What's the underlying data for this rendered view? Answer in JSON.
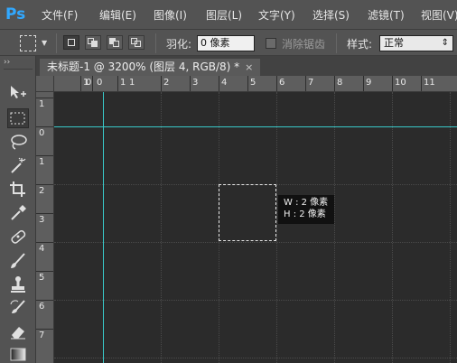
{
  "app": {
    "logo": "Ps"
  },
  "menu": {
    "items": [
      "文件(F)",
      "编辑(E)",
      "图像(I)",
      "图层(L)",
      "文字(Y)",
      "选择(S)",
      "滤镜(T)",
      "视图(V)"
    ]
  },
  "options": {
    "feather_label": "羽化:",
    "feather_value": "0 像素",
    "antialias_label": "消除锯齿",
    "style_label": "样式:",
    "style_value": "正常",
    "style_arrow": "⇕"
  },
  "tools": {
    "collapse": "››",
    "icons": [
      "move-tool-icon",
      "marquee-tool-icon",
      "lasso-tool-icon",
      "magic-wand-tool-icon",
      "crop-tool-icon",
      "eyedropper-tool-icon",
      "healing-brush-tool-icon",
      "brush-tool-icon",
      "clone-stamp-tool-icon",
      "history-brush-tool-icon",
      "eraser-tool-icon",
      "gradient-tool-icon"
    ]
  },
  "document": {
    "tab_title": "未标题-1 @ 3200% (图层 4, RGB/8) *",
    "close": "×"
  },
  "ruler": {
    "h_labels": [
      "1",
      "0",
      "0",
      "1",
      "1",
      "2",
      "3",
      "4",
      "5",
      "6",
      "7",
      "8",
      "9",
      "10",
      "11"
    ],
    "v_labels": [
      "1",
      "0",
      "1",
      "2",
      "3",
      "4",
      "5",
      "6",
      "7"
    ]
  },
  "selection_info": {
    "w": "W : 2 像素",
    "h": "H : 2 像素"
  },
  "colors": {
    "guide": "#38c8c8",
    "canvas": "#2b2b2b",
    "ps_blue": "#31a8ff"
  }
}
